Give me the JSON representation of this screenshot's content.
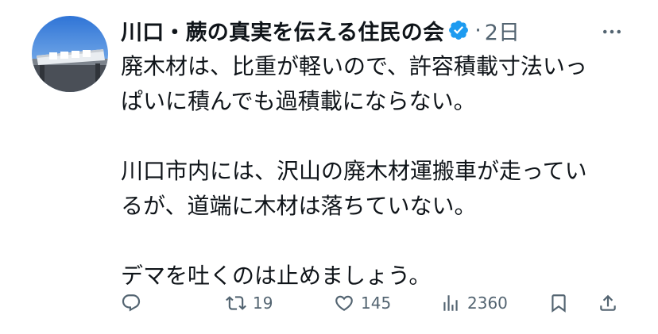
{
  "post": {
    "author_name": "川口・蕨の真実を伝える住民の会",
    "separator": "·",
    "time": "2日",
    "paragraphs": [
      {
        "lines": [
          "廃木材は、比重が軽いので、許容積載寸法いっ",
          "ぱいに積んでも過積載にならない。"
        ]
      },
      {
        "lines": [
          "川口市内には、沢山の廃木材運搬車が走ってい",
          "るが、道端に木材は落ちていない。"
        ]
      },
      {
        "lines": [
          "デマを吐くのは止めましょう。"
        ]
      }
    ]
  },
  "actions": {
    "reply_count": "",
    "retweet_count": "19",
    "like_count": "145",
    "view_count": "2360"
  },
  "icons": {
    "verified": "verified-badge-icon",
    "more": "more-options-icon",
    "reply": "reply-icon",
    "retweet": "retweet-icon",
    "like": "heart-icon",
    "views": "views-chart-icon",
    "bookmark": "bookmark-icon",
    "share": "share-icon"
  },
  "colors": {
    "text": "#0f1419",
    "secondary": "#536471",
    "verified_blue": "#1d9bf0"
  }
}
